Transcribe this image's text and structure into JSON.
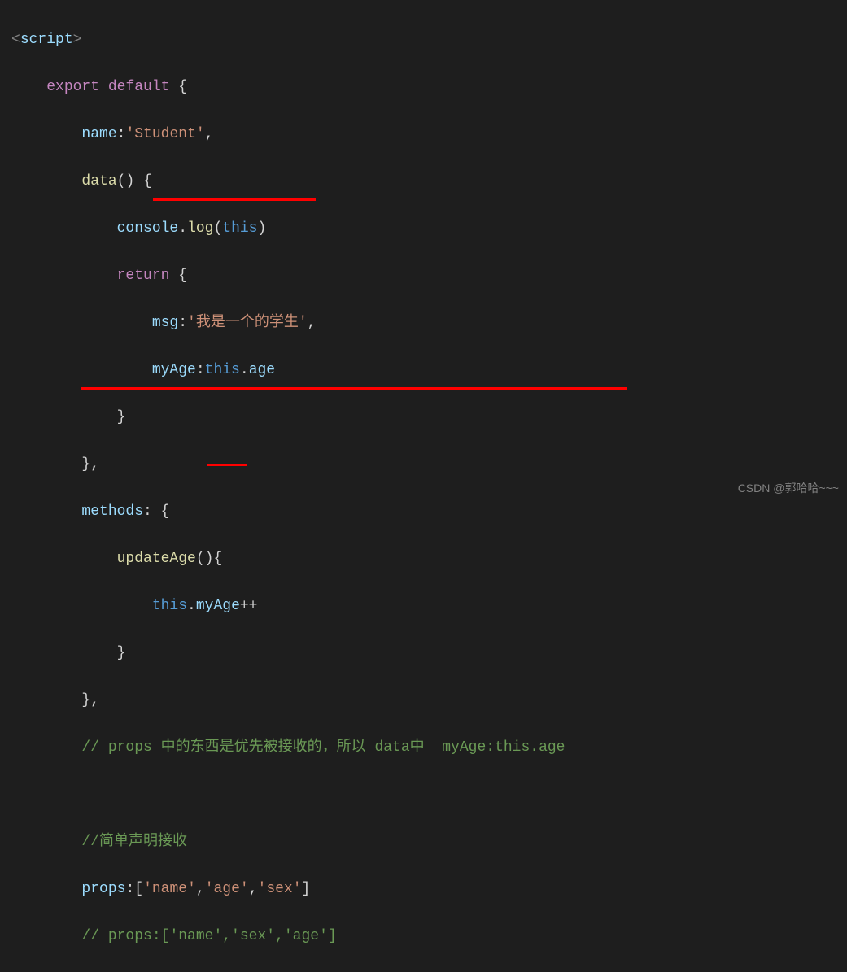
{
  "code": {
    "line1": {
      "tag_open": "<",
      "tag_name": "script",
      "tag_close": ">"
    },
    "line2": {
      "export": "export",
      "default": "default",
      "brace": " {"
    },
    "line3": {
      "prop": "name",
      "colon": ":",
      "value": "'Student'",
      "comma": ","
    },
    "line4": {
      "method": "data",
      "parens": "()",
      "brace": " {"
    },
    "line5": {
      "obj": "console",
      "dot": ".",
      "method": "log",
      "paren_open": "(",
      "this": "this",
      "paren_close": ")"
    },
    "line6": {
      "return": "return",
      "brace": " {"
    },
    "line7": {
      "prop": "msg",
      "colon": ":",
      "value": "'我是一个的学生'",
      "comma": ","
    },
    "line8": {
      "prop": "myAge",
      "colon": ":",
      "this": "this",
      "dot": ".",
      "age": "age"
    },
    "line9": {
      "brace": "}"
    },
    "line10": {
      "brace": "}",
      "comma": ","
    },
    "line11": {
      "prop": "methods",
      "colon": ":",
      "brace": " {"
    },
    "line12": {
      "method": "updateAge",
      "parens": "()",
      "brace": "{"
    },
    "line13": {
      "this": "this",
      "dot": ".",
      "prop": "myAge",
      "op": "++"
    },
    "line14": {
      "brace": "}"
    },
    "line15": {
      "brace": "}",
      "comma": ","
    },
    "line16": {
      "comment": "// ",
      "text1": "props ",
      "text2": "中的东西是优先被接收的，所以 ",
      "text3": "data中  myAge:this.age"
    },
    "line17": {
      "blank": ""
    },
    "line18": {
      "comment": "//简单声明接收"
    },
    "line19": {
      "prop": "props",
      "colon": ":",
      "bracket_open": "[",
      "v1": "'name'",
      "c1": ",",
      "v2": "'age'",
      "c2": ",",
      "v3": "'sex'",
      "bracket_close": "]"
    },
    "line20": {
      "comment": "// props:['name','sex','age']"
    }
  },
  "watermark": "CSDN @郭哈哈~~~"
}
